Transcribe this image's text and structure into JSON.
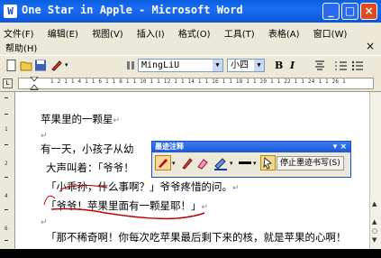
{
  "window": {
    "title": "One Star in Apple - Microsoft Word"
  },
  "menu": {
    "items": [
      "文件(F)",
      "编辑(E)",
      "视图(V)",
      "插入(I)",
      "格式(O)",
      "工具(T)",
      "表格(A)",
      "窗口(W)"
    ],
    "help": "帮助(H)",
    "close_doc": "×"
  },
  "toolbar": {
    "font_name": "MingLiU",
    "font_size": "小四",
    "bold": "B",
    "italic": "I"
  },
  "ruler": {
    "numbers": "1 2 1   1 4 1   1 6 1   1 8 1   1 10 1   1 12 1   1 14 1   1 16 1   1 18 1   1 20 1   1 22 1   1 24 1   1 26 1"
  },
  "document": {
    "lines": [
      "苹果里的一颗星",
      "",
      "有一天，小孩子从幼",
      "大声叫着：「爷爷！",
      "「小乖孙，什么事啊？」爷爷疼惜的问。",
      "「爷爷！苹果里面有一颗星耶！」",
      "",
      "「那不稀奇啊！你每次吃苹果最后剩下来的核，就是苹果的心啊！"
    ],
    "return_mark": "↵"
  },
  "ink_palette": {
    "title": "墨迹注释",
    "stop_button": "停止墨迹书写(S)"
  },
  "colors": {
    "title_blue": "#0a5fe0",
    "ink_red": "#c00000",
    "palette_border": "#1a4fbf"
  }
}
